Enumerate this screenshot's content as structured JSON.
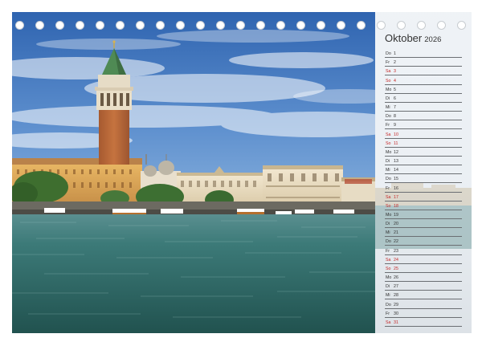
{
  "calendar": {
    "month": "Oktober",
    "year": "2026",
    "days": [
      {
        "wd": "Do",
        "d": "1",
        "weekend": false
      },
      {
        "wd": "Fr",
        "d": "2",
        "weekend": false
      },
      {
        "wd": "Sa",
        "d": "3",
        "weekend": true
      },
      {
        "wd": "So",
        "d": "4",
        "weekend": true
      },
      {
        "wd": "Mo",
        "d": "5",
        "weekend": false
      },
      {
        "wd": "Di",
        "d": "6",
        "weekend": false
      },
      {
        "wd": "Mi",
        "d": "7",
        "weekend": false
      },
      {
        "wd": "Do",
        "d": "8",
        "weekend": false
      },
      {
        "wd": "Fr",
        "d": "9",
        "weekend": false
      },
      {
        "wd": "Sa",
        "d": "10",
        "weekend": true
      },
      {
        "wd": "So",
        "d": "11",
        "weekend": true
      },
      {
        "wd": "Mo",
        "d": "12",
        "weekend": false
      },
      {
        "wd": "Di",
        "d": "13",
        "weekend": false
      },
      {
        "wd": "Mi",
        "d": "14",
        "weekend": false
      },
      {
        "wd": "Do",
        "d": "15",
        "weekend": false
      },
      {
        "wd": "Fr",
        "d": "16",
        "weekend": false
      },
      {
        "wd": "Sa",
        "d": "17",
        "weekend": true
      },
      {
        "wd": "So",
        "d": "18",
        "weekend": true
      },
      {
        "wd": "Mo",
        "d": "19",
        "weekend": false
      },
      {
        "wd": "Di",
        "d": "20",
        "weekend": false
      },
      {
        "wd": "Mi",
        "d": "21",
        "weekend": false
      },
      {
        "wd": "Do",
        "d": "22",
        "weekend": false
      },
      {
        "wd": "Fr",
        "d": "23",
        "weekend": false
      },
      {
        "wd": "Sa",
        "d": "24",
        "weekend": true
      },
      {
        "wd": "So",
        "d": "25",
        "weekend": true
      },
      {
        "wd": "Mo",
        "d": "26",
        "weekend": false
      },
      {
        "wd": "Di",
        "d": "27",
        "weekend": false
      },
      {
        "wd": "Mi",
        "d": "28",
        "weekend": false
      },
      {
        "wd": "Do",
        "d": "29",
        "weekend": false
      },
      {
        "wd": "Fr",
        "d": "30",
        "weekend": false
      },
      {
        "wd": "Sa",
        "d": "31",
        "weekend": true
      }
    ]
  },
  "colors": {
    "weekend": "#c62828",
    "text": "#333333",
    "rule": "#6b6f73",
    "sky": "#3f7ac2",
    "lagoon": "#2f6f6c",
    "campanile_brick": "#b9683a",
    "roof_green": "#4f8a54"
  },
  "binding": {
    "holes": 23
  }
}
